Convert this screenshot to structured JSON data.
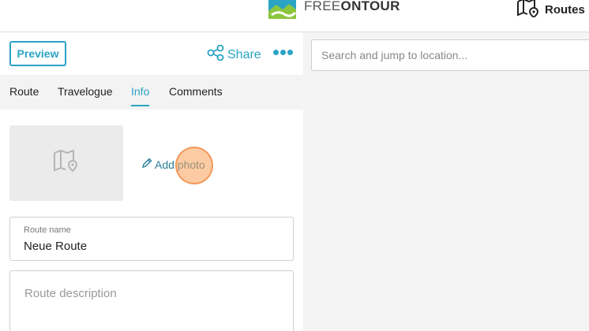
{
  "header": {
    "brand": {
      "prefix": "FREE",
      "suffix": "ONTOUR"
    },
    "routes_label": "Routes"
  },
  "toolbar": {
    "preview_label": "Preview",
    "share_label": "Share"
  },
  "tabs": [
    {
      "label": "Route",
      "active": false
    },
    {
      "label": "Travelogue",
      "active": false
    },
    {
      "label": "Info",
      "active": true
    },
    {
      "label": "Comments",
      "active": false
    }
  ],
  "info": {
    "add_photo_label": "Add photo",
    "route_name_label": "Route name",
    "route_name_value": "Neue Route",
    "route_description_placeholder": "Route description"
  },
  "map": {
    "search_placeholder": "Search and jump to location..."
  },
  "colors": {
    "accent": "#2aa3c4",
    "link": "#2a7f9c"
  },
  "icons": {
    "share": "share-icon",
    "more": "more-dots-icon",
    "routes": "map-pin-icon",
    "photo_placeholder": "map-placeholder-icon",
    "edit": "pencil-icon"
  }
}
